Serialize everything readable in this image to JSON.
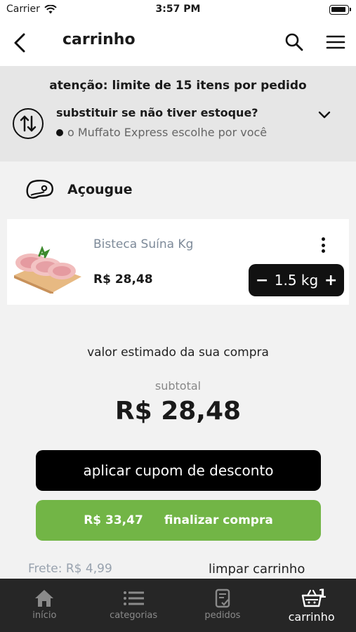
{
  "status_bar": {
    "carrier": "Carrier",
    "time": "3:57 PM"
  },
  "nav": {
    "title": "carrinho"
  },
  "notice": {
    "limit_text": "atenção: limite de 15 itens por pedido",
    "substitution_title": "substituir se não tiver estoque?",
    "substitution_option": "o Muffato Express escolhe por você"
  },
  "section": {
    "name": "Açougue",
    "icon": "meat-icon"
  },
  "cart_item": {
    "name": "Bisteca Suína Kg",
    "price": "R$ 28,48",
    "quantity": "1.5 kg",
    "decrement_label": "−",
    "increment_label": "+"
  },
  "summary": {
    "estimate_label": "valor estimado da sua compra",
    "subtotal_label": "subtotal",
    "subtotal_value": "R$ 28,48"
  },
  "actions": {
    "coupon_label": "aplicar cupom de desconto",
    "checkout_total": "R$ 33,47",
    "checkout_label": "finalizar compra",
    "shipping": "Frete: R$ 4,99",
    "clear_label": "limpar carrinho"
  },
  "tabs": [
    {
      "label": "início",
      "icon": "home-icon"
    },
    {
      "label": "categorias",
      "icon": "list-icon"
    },
    {
      "label": "pedidos",
      "icon": "orders-icon"
    },
    {
      "label": "carrinho",
      "icon": "basket-icon",
      "badge": "1",
      "active": true
    }
  ],
  "colors": {
    "accent_green": "#72b546",
    "tab_bar": "#262626",
    "notice_bg": "#e6e6e6"
  }
}
